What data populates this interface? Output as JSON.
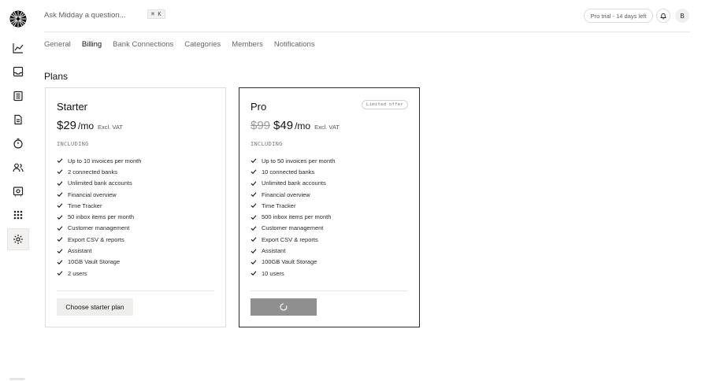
{
  "search": {
    "placeholder": "Ask Midday a question...",
    "shortcut": "⌘ K"
  },
  "header": {
    "trial_text": "Pro trial - 14 days left",
    "avatar_initial": "B"
  },
  "sidebar": {
    "items": [
      {
        "name": "overview",
        "icon": "chart-line-icon"
      },
      {
        "name": "inbox",
        "icon": "inbox-icon"
      },
      {
        "name": "transactions",
        "icon": "receipt-icon"
      },
      {
        "name": "invoices",
        "icon": "document-icon"
      },
      {
        "name": "tracker",
        "icon": "timer-icon"
      },
      {
        "name": "customers",
        "icon": "users-icon"
      },
      {
        "name": "vault",
        "icon": "vault-icon"
      },
      {
        "name": "apps",
        "icon": "grid-icon"
      },
      {
        "name": "settings",
        "icon": "gear-icon",
        "active": true
      }
    ]
  },
  "tabs": [
    {
      "label": "General",
      "active": false
    },
    {
      "label": "Billing",
      "active": true
    },
    {
      "label": "Bank Connections",
      "active": false
    },
    {
      "label": "Categories",
      "active": false
    },
    {
      "label": "Members",
      "active": false
    },
    {
      "label": "Notifications",
      "active": false
    }
  ],
  "plans": {
    "title": "Plans",
    "starter": {
      "name": "Starter",
      "price": "$29",
      "period": "/mo",
      "vat": "Excl. VAT",
      "including": "INCLUDING",
      "features": [
        "Up to 10 invoices per month",
        "2 connected banks",
        "Unlimited bank accounts",
        "Financial overview",
        "Time Tracker",
        "50 inbox items per month",
        "Customer management",
        "Export CSV & reports",
        "Assistant",
        "10GB Vault Storage",
        "2 users"
      ],
      "button_label": "Choose starter plan"
    },
    "pro": {
      "name": "Pro",
      "badge": "Limited offer",
      "old_price": "$99",
      "price": "$49",
      "period": "/mo",
      "vat": "Excl. VAT",
      "including": "INCLUDING",
      "features": [
        "Up to 50 invoices per month",
        "10 connected banks",
        "Unlimited bank accounts",
        "Financial overview",
        "Time Tracker",
        "500 inbox items per month",
        "Customer management",
        "Export CSV & reports",
        "Assistant",
        "100GB Vault Storage",
        "10 users"
      ],
      "button_state": "loading"
    }
  },
  "colors": {
    "accent": "#121212",
    "border": "#dcdcdc",
    "button_loading": "#8f8f8f"
  }
}
